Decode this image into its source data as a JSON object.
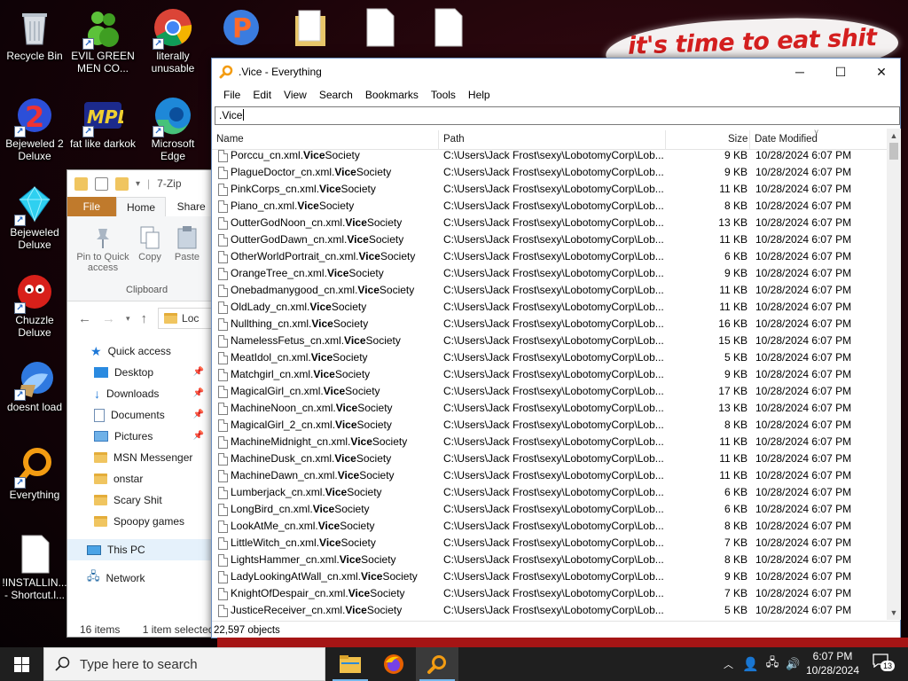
{
  "desktop": {
    "banner_text": "it's time to eat shit",
    "icons": [
      {
        "label": "Recycle Bin"
      },
      {
        "label": "EVIL GREEN MEN CO..."
      },
      {
        "label": "literally unusable"
      },
      {
        "label": "Bejeweled 2 Deluxe"
      },
      {
        "label": "fat like darkok"
      },
      {
        "label": "Microsoft Edge"
      },
      {
        "label": "Bejeweled Deluxe"
      },
      {
        "label": "Chuzzle Deluxe"
      },
      {
        "label": "doesnt load"
      },
      {
        "label": "Everything"
      },
      {
        "label": "!INSTALLIN... - Shortcut.l..."
      }
    ]
  },
  "explorer": {
    "title": "7-Zip",
    "tabs": {
      "file": "File",
      "home": "Home",
      "share": "Share"
    },
    "ribbon": {
      "pin": "Pin to Quick access",
      "copy": "Copy",
      "paste": "Paste",
      "group": "Clipboard"
    },
    "address": "Loc",
    "tree": {
      "quick_access": "Quick access",
      "desktop": "Desktop",
      "downloads": "Downloads",
      "documents": "Documents",
      "pictures": "Pictures",
      "msn": "MSN Messenger",
      "onstar": "onstar",
      "scary": "Scary Shit",
      "spoopy": "Spoopy games",
      "this_pc": "This PC",
      "network": "Network"
    },
    "status": {
      "items": "16 items",
      "selected": "1 item selected"
    }
  },
  "everything": {
    "title": ".Vice - Everything",
    "menu": [
      "File",
      "Edit",
      "View",
      "Search",
      "Bookmarks",
      "Tools",
      "Help"
    ],
    "search_value": ".Vice",
    "columns": {
      "name": "Name",
      "path": "Path",
      "size": "Size",
      "date": "Date Modified"
    },
    "rows": [
      {
        "prefix": "Porccu_cn.xml.",
        "match": "Vice",
        "suffix": "Society",
        "path": "C:\\Users\\Jack Frost\\sexy\\LobotomyCorp\\Lob...",
        "size": "9 KB",
        "date": "10/28/2024 6:07 PM"
      },
      {
        "prefix": "PlagueDoctor_cn.xml.",
        "match": "Vice",
        "suffix": "Society",
        "path": "C:\\Users\\Jack Frost\\sexy\\LobotomyCorp\\Lob...",
        "size": "9 KB",
        "date": "10/28/2024 6:07 PM"
      },
      {
        "prefix": "PinkCorps_cn.xml.",
        "match": "Vice",
        "suffix": "Society",
        "path": "C:\\Users\\Jack Frost\\sexy\\LobotomyCorp\\Lob...",
        "size": "11 KB",
        "date": "10/28/2024 6:07 PM"
      },
      {
        "prefix": "Piano_cn.xml.",
        "match": "Vice",
        "suffix": "Society",
        "path": "C:\\Users\\Jack Frost\\sexy\\LobotomyCorp\\Lob...",
        "size": "8 KB",
        "date": "10/28/2024 6:07 PM"
      },
      {
        "prefix": "OutterGodNoon_cn.xml.",
        "match": "Vice",
        "suffix": "Society",
        "path": "C:\\Users\\Jack Frost\\sexy\\LobotomyCorp\\Lob...",
        "size": "13 KB",
        "date": "10/28/2024 6:07 PM"
      },
      {
        "prefix": "OutterGodDawn_cn.xml.",
        "match": "Vice",
        "suffix": "Society",
        "path": "C:\\Users\\Jack Frost\\sexy\\LobotomyCorp\\Lob...",
        "size": "11 KB",
        "date": "10/28/2024 6:07 PM"
      },
      {
        "prefix": "OtherWorldPortrait_cn.xml.",
        "match": "Vice",
        "suffix": "Society",
        "path": "C:\\Users\\Jack Frost\\sexy\\LobotomyCorp\\Lob...",
        "size": "6 KB",
        "date": "10/28/2024 6:07 PM"
      },
      {
        "prefix": "OrangeTree_cn.xml.",
        "match": "Vice",
        "suffix": "Society",
        "path": "C:\\Users\\Jack Frost\\sexy\\LobotomyCorp\\Lob...",
        "size": "9 KB",
        "date": "10/28/2024 6:07 PM"
      },
      {
        "prefix": "Onebadmanygood_cn.xml.",
        "match": "Vice",
        "suffix": "Society",
        "path": "C:\\Users\\Jack Frost\\sexy\\LobotomyCorp\\Lob...",
        "size": "11 KB",
        "date": "10/28/2024 6:07 PM"
      },
      {
        "prefix": "OldLady_cn.xml.",
        "match": "Vice",
        "suffix": "Society",
        "path": "C:\\Users\\Jack Frost\\sexy\\LobotomyCorp\\Lob...",
        "size": "11 KB",
        "date": "10/28/2024 6:07 PM"
      },
      {
        "prefix": "Nullthing_cn.xml.",
        "match": "Vice",
        "suffix": "Society",
        "path": "C:\\Users\\Jack Frost\\sexy\\LobotomyCorp\\Lob...",
        "size": "16 KB",
        "date": "10/28/2024 6:07 PM"
      },
      {
        "prefix": "NamelessFetus_cn.xml.",
        "match": "Vice",
        "suffix": "Society",
        "path": "C:\\Users\\Jack Frost\\sexy\\LobotomyCorp\\Lob...",
        "size": "15 KB",
        "date": "10/28/2024 6:07 PM"
      },
      {
        "prefix": "MeatIdol_cn.xml.",
        "match": "Vice",
        "suffix": "Society",
        "path": "C:\\Users\\Jack Frost\\sexy\\LobotomyCorp\\Lob...",
        "size": "5 KB",
        "date": "10/28/2024 6:07 PM"
      },
      {
        "prefix": "Matchgirl_cn.xml.",
        "match": "Vice",
        "suffix": "Society",
        "path": "C:\\Users\\Jack Frost\\sexy\\LobotomyCorp\\Lob...",
        "size": "9 KB",
        "date": "10/28/2024 6:07 PM"
      },
      {
        "prefix": "MagicalGirl_cn.xml.",
        "match": "Vice",
        "suffix": "Society",
        "path": "C:\\Users\\Jack Frost\\sexy\\LobotomyCorp\\Lob...",
        "size": "17 KB",
        "date": "10/28/2024 6:07 PM"
      },
      {
        "prefix": "MachineNoon_cn.xml.",
        "match": "Vice",
        "suffix": "Society",
        "path": "C:\\Users\\Jack Frost\\sexy\\LobotomyCorp\\Lob...",
        "size": "13 KB",
        "date": "10/28/2024 6:07 PM"
      },
      {
        "prefix": "MagicalGirl_2_cn.xml.",
        "match": "Vice",
        "suffix": "Society",
        "path": "C:\\Users\\Jack Frost\\sexy\\LobotomyCorp\\Lob...",
        "size": "8 KB",
        "date": "10/28/2024 6:07 PM"
      },
      {
        "prefix": "MachineMidnight_cn.xml.",
        "match": "Vice",
        "suffix": "Society",
        "path": "C:\\Users\\Jack Frost\\sexy\\LobotomyCorp\\Lob...",
        "size": "11 KB",
        "date": "10/28/2024 6:07 PM"
      },
      {
        "prefix": "MachineDusk_cn.xml.",
        "match": "Vice",
        "suffix": "Society",
        "path": "C:\\Users\\Jack Frost\\sexy\\LobotomyCorp\\Lob...",
        "size": "11 KB",
        "date": "10/28/2024 6:07 PM"
      },
      {
        "prefix": "MachineDawn_cn.xml.",
        "match": "Vice",
        "suffix": "Society",
        "path": "C:\\Users\\Jack Frost\\sexy\\LobotomyCorp\\Lob...",
        "size": "11 KB",
        "date": "10/28/2024 6:07 PM"
      },
      {
        "prefix": "Lumberjack_cn.xml.",
        "match": "Vice",
        "suffix": "Society",
        "path": "C:\\Users\\Jack Frost\\sexy\\LobotomyCorp\\Lob...",
        "size": "6 KB",
        "date": "10/28/2024 6:07 PM"
      },
      {
        "prefix": "LongBird_cn.xml.",
        "match": "Vice",
        "suffix": "Society",
        "path": "C:\\Users\\Jack Frost\\sexy\\LobotomyCorp\\Lob...",
        "size": "6 KB",
        "date": "10/28/2024 6:07 PM"
      },
      {
        "prefix": "LookAtMe_cn.xml.",
        "match": "Vice",
        "suffix": "Society",
        "path": "C:\\Users\\Jack Frost\\sexy\\LobotomyCorp\\Lob...",
        "size": "8 KB",
        "date": "10/28/2024 6:07 PM"
      },
      {
        "prefix": "LittleWitch_cn.xml.",
        "match": "Vice",
        "suffix": "Society",
        "path": "C:\\Users\\Jack Frost\\sexy\\LobotomyCorp\\Lob...",
        "size": "7 KB",
        "date": "10/28/2024 6:07 PM"
      },
      {
        "prefix": "LightsHammer_cn.xml.",
        "match": "Vice",
        "suffix": "Society",
        "path": "C:\\Users\\Jack Frost\\sexy\\LobotomyCorp\\Lob...",
        "size": "8 KB",
        "date": "10/28/2024 6:07 PM"
      },
      {
        "prefix": "LadyLookingAtWall_cn.xml.",
        "match": "Vice",
        "suffix": "Society",
        "path": "C:\\Users\\Jack Frost\\sexy\\LobotomyCorp\\Lob...",
        "size": "9 KB",
        "date": "10/28/2024 6:07 PM"
      },
      {
        "prefix": "KnightOfDespair_cn.xml.",
        "match": "Vice",
        "suffix": "Society",
        "path": "C:\\Users\\Jack Frost\\sexy\\LobotomyCorp\\Lob...",
        "size": "7 KB",
        "date": "10/28/2024 6:07 PM"
      },
      {
        "prefix": "JusticeReceiver_cn.xml.",
        "match": "Vice",
        "suffix": "Society",
        "path": "C:\\Users\\Jack Frost\\sexy\\LobotomyCorp\\Lob...",
        "size": "5 KB",
        "date": "10/28/2024 6:07 PM"
      }
    ],
    "status": "22,597 objects"
  },
  "taskbar": {
    "search_placeholder": "Type here to search",
    "time": "6:07 PM",
    "date": "10/28/2024",
    "notification_count": "13"
  },
  "colors": {
    "accent": "#0078d7",
    "everything_icon": "#f39c12",
    "taskbar_bg": "#1f1f1f",
    "explorer_file_tab": "#c07a2c"
  }
}
